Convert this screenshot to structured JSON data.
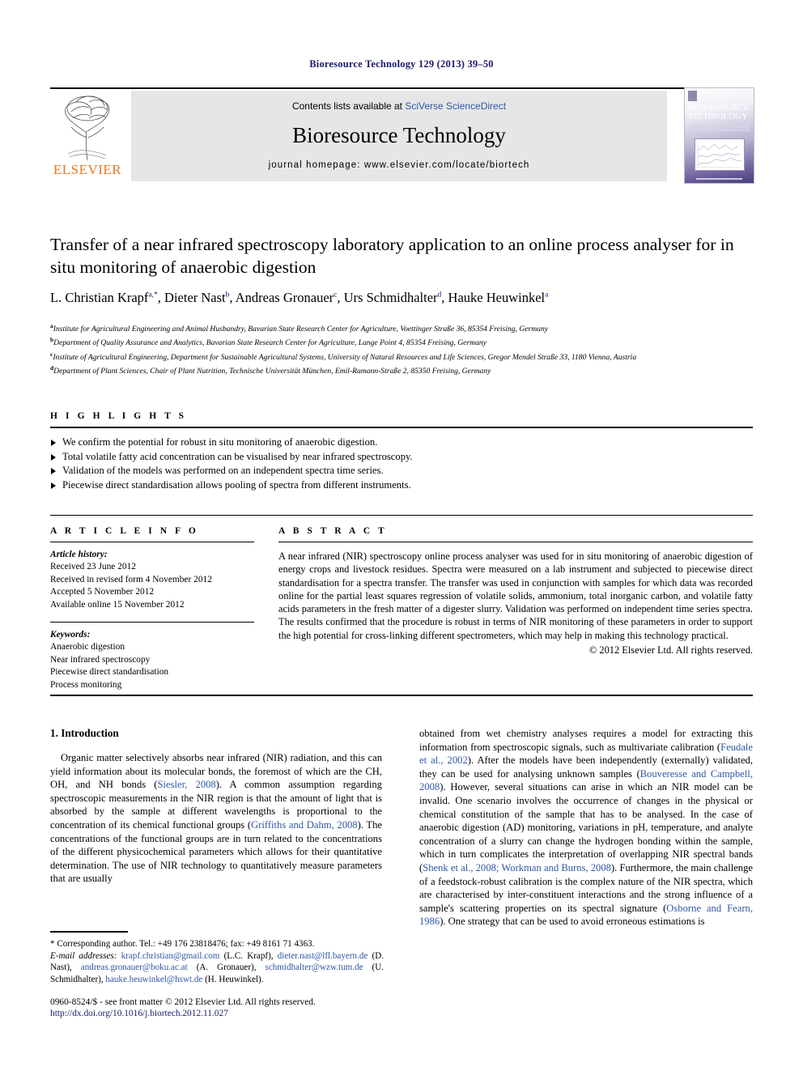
{
  "running_head": "Bioresource Technology 129 (2013) 39–50",
  "masthead": {
    "contents_prefix": "Contents lists available at ",
    "sciencedirect": "SciVerse ScienceDirect",
    "journal_name": "Bioresource Technology",
    "homepage": "journal homepage: www.elsevier.com/locate/biortech",
    "publisher": "ELSEVIER",
    "cover_title": "BIORESOURCE TECHNOLOGY",
    "accent_color": "#2f57a6",
    "publisher_color": "#e87722"
  },
  "article": {
    "title": "Transfer of a near infrared spectroscopy laboratory application to an online process analyser for in situ monitoring of anaerobic digestion",
    "authors": [
      {
        "name": "L. Christian Krapf",
        "marks": "a,*"
      },
      {
        "name": "Dieter Nast",
        "marks": "b"
      },
      {
        "name": "Andreas Gronauer",
        "marks": "c"
      },
      {
        "name": "Urs Schmidhalter",
        "marks": "d"
      },
      {
        "name": "Hauke Heuwinkel",
        "marks": "a"
      }
    ],
    "affiliations": [
      {
        "mark": "a",
        "text": "Institute for Agricultural Engineering and Animal Husbandry, Bavarian State Research Center for Agriculture, Voettinger Straße 36, 85354 Freising, Germany"
      },
      {
        "mark": "b",
        "text": "Department of Quality Assurance and Analytics, Bavarian State Research Center for Agriculture, Lange Point 4, 85354 Freising, Germany"
      },
      {
        "mark": "c",
        "text": "Institute of Agricultural Engineering, Department for Sustainable Agricultural Systems, University of Natural Resources and Life Sciences, Gregor Mendel Straße 33, 1180 Vienna, Austria"
      },
      {
        "mark": "d",
        "text": "Department of Plant Sciences, Chair of Plant Nutrition, Technische Universität München, Emil-Ramann-Straße 2, 85350 Freising, Germany"
      }
    ]
  },
  "highlights": {
    "heading": "H I G H L I G H T S",
    "items": [
      "We confirm the potential for robust in situ monitoring of anaerobic digestion.",
      "Total volatile fatty acid concentration can be visualised by near infrared spectroscopy.",
      "Validation of the models was performed on an independent spectra time series.",
      "Piecewise direct standardisation allows pooling of spectra from different instruments."
    ]
  },
  "article_info": {
    "heading": "A R T I C L E    I N F O",
    "history_label": "Article history:",
    "history": [
      "Received 23 June 2012",
      "Received in revised form 4 November 2012",
      "Accepted 5 November 2012",
      "Available online 15 November 2012"
    ],
    "keywords_label": "Keywords:",
    "keywords": [
      "Anaerobic digestion",
      "Near infrared spectroscopy",
      "Piecewise direct standardisation",
      "Process monitoring"
    ]
  },
  "abstract": {
    "heading": "A B S T R A C T",
    "text": "A near infrared (NIR) spectroscopy online process analyser was used for in situ monitoring of anaerobic digestion of energy crops and livestock residues. Spectra were measured on a lab instrument and subjected to piecewise direct standardisation for a spectra transfer. The transfer was used in conjunction with samples for which data was recorded online for the partial least squares regression of volatile solids, ammonium, total inorganic carbon, and volatile fatty acids parameters in the fresh matter of a digester slurry. Validation was performed on independent time series spectra. The results confirmed that the procedure is robust in terms of NIR monitoring of these parameters in order to support the high potential for cross-linking different spectrometers, which may help in making this technology practical.",
    "copyright": "© 2012 Elsevier Ltd. All rights reserved."
  },
  "introduction": {
    "heading": "1. Introduction",
    "left_paragraph_a": "Organic matter selectively absorbs near infrared (NIR) radiation, and this can yield information about its molecular bonds, the foremost of which are the CH, OH, and NH bonds (",
    "left_cite_1": "Siesler, 2008",
    "left_paragraph_b": "). A common assumption regarding spectroscopic measurements in the NIR region is that the amount of light that is absorbed by the sample at different wavelengths is proportional to the concentration of its chemical functional groups (",
    "left_cite_2": "Griffiths and Dahm, 2008",
    "left_paragraph_c": "). The concentrations of the functional groups are in turn related to the concentrations of the different physicochemical parameters which allows for their quantitative determination. The use of NIR technology to quantitatively measure parameters that are usually",
    "right_paragraph_a": "obtained from wet chemistry analyses requires a model for extracting this information from spectroscopic signals, such as multivariate calibration (",
    "right_cite_1": "Feudale et al., 2002",
    "right_paragraph_b": "). After the models have been independently (externally) validated, they can be used for analysing unknown samples (",
    "right_cite_2": "Bouveresse and Campbell, 2008",
    "right_paragraph_c": "). However, several situations can arise in which an NIR model can be invalid. One scenario involves the occurrence of changes in the physical or chemical constitution of the sample that has to be analysed. In the case of anaerobic digestion (AD) monitoring, variations in pH, temperature, and analyte concentration of a slurry can change the hydrogen bonding within the sample, which in turn complicates the interpretation of overlapping NIR spectral bands (",
    "right_cite_3": "Shenk et al., 2008; Workman and Burns, 2008",
    "right_paragraph_d": "). Furthermore, the main challenge of a feedstock-robust calibration is the complex nature of the NIR spectra, which are characterised by inter-constituent interactions and the strong influence of a sample's scattering properties on its spectral signature (",
    "right_cite_4": "Osborne and Fearn, 1986",
    "right_paragraph_e": "). One strategy that can be used to avoid erroneous estimations is"
  },
  "footnotes": {
    "corresponding": "* Corresponding author. Tel.: +49 176 23818476; fax: +49 8161 71 4363.",
    "email_label": "E-mail addresses:",
    "emails": [
      {
        "address": "krapf.christian@gmail.com",
        "owner": "(L.C. Krapf)"
      },
      {
        "address": "dieter.nast@lfl.bayern.de",
        "owner": "(D. Nast)"
      },
      {
        "address": "andreas.gronauer@boku.ac.at",
        "owner": "(A. Gronauer)"
      },
      {
        "address": "schmidhalter@wzw.tum.de",
        "owner": "(U. Schmidhalter)"
      },
      {
        "address": "hauke.heuwinkel@hswt.de",
        "owner": "(H. Heuwinkel)"
      }
    ]
  },
  "imprint": {
    "issn_line": "0960-8524/$ - see front matter © 2012 Elsevier Ltd. All rights reserved.",
    "doi": "http://dx.doi.org/10.1016/j.biortech.2012.11.027"
  }
}
